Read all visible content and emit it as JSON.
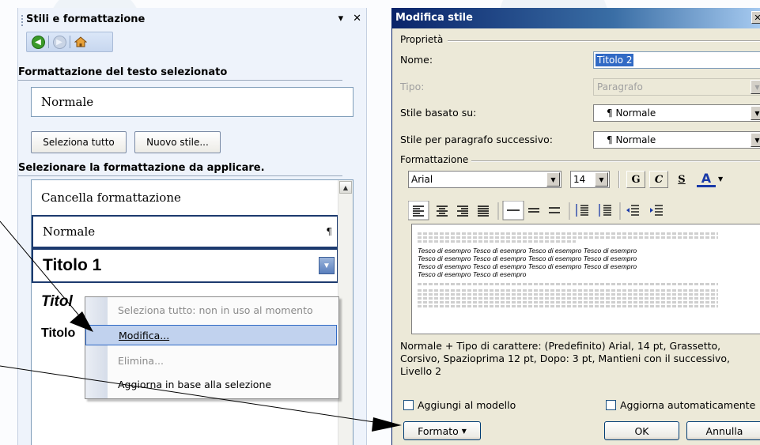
{
  "task_pane": {
    "title": "Stili e formattazione",
    "selected_heading": "Formattazione del testo selezionato",
    "current_style": "Normale",
    "select_all_button": "Seleziona tutto",
    "new_style_button": "Nuovo stile...",
    "apply_heading": "Selezionare la formattazione da applicare.",
    "styles": [
      {
        "label": "Cancella formattazione"
      },
      {
        "label": "Normale",
        "mark": "¶"
      },
      {
        "label": "Titolo 1"
      },
      {
        "label": "Titol"
      },
      {
        "label": "Titolo"
      }
    ],
    "context_menu": [
      {
        "label": "Seleziona tutto: non in uso al momento",
        "disabled": true
      },
      {
        "label": "Modifica...",
        "highlighted": true
      },
      {
        "label": "Elimina...",
        "disabled": true
      },
      {
        "label": "Aggiorna in base alla selezione"
      }
    ]
  },
  "dialog": {
    "title": "Modifica stile",
    "properties_group": "Proprietà",
    "name_label": "Nome:",
    "name_value": "Titolo 2",
    "type_label": "Tipo:",
    "type_value": "Paragrafo",
    "based_on_label": "Stile basato su:",
    "based_on_value": "¶ Normale",
    "next_style_label": "Stile per paragrafo successivo:",
    "next_style_value": "¶ Normale",
    "formatting_group": "Formattazione",
    "font_value": "Arial",
    "size_value": "14",
    "bold_glyph": "G",
    "italic_glyph": "C",
    "underline_glyph": "S",
    "color_glyph": "A",
    "preview_lines": [
      "Tesco di esempro Tesco di esempro Tesco di esempro Tesco di esempro",
      "Tesco di esempro Tesco di esempro Tesco di esempro Tesco di esempro",
      "Tesco di esempro Tesco di esempro Tesco di esempro Tesco di esempro",
      "Tesco di esempro Tesco di esempro"
    ],
    "description": "Normale + Tipo di carattere: (Predefinito) Arial, 14 pt, Grassetto, Corsivo, Spazioprima 12 pt, Dopo:  3 pt, Mantieni con il successivo, Livello 2",
    "add_to_template_label": "Aggiungi al modello",
    "auto_update_label": "Aggiorna automaticamente",
    "format_button": "Formato",
    "ok_button": "OK",
    "cancel_button": "Annulla"
  },
  "colors": {
    "pane_bg": "#eef3fb",
    "dialog_bg": "#ece9d8",
    "title_bar": "#0a246a",
    "selection": "#c1d2ee"
  }
}
